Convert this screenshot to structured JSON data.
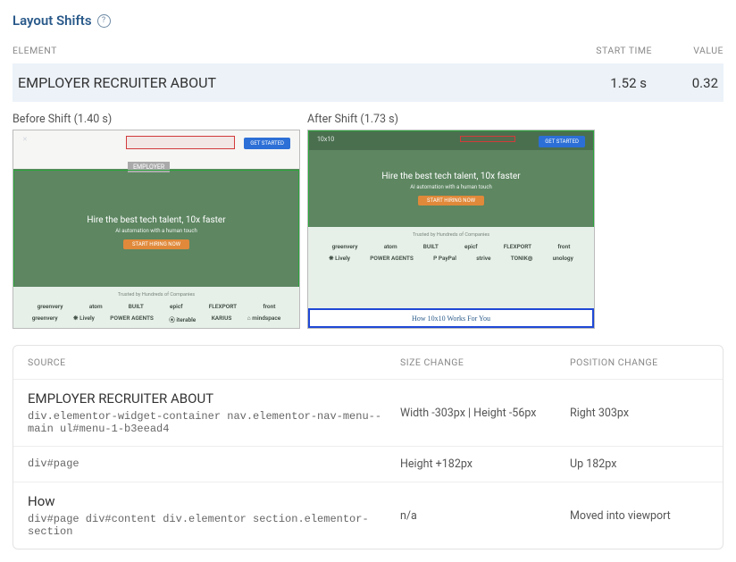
{
  "section": {
    "title": "Layout Shifts"
  },
  "header": {
    "element": "ELEMENT",
    "start": "START TIME",
    "value": "VALUE"
  },
  "selected": {
    "element": "EMPLOYER RECRUITER ABOUT",
    "start": "1.52 s",
    "value": "0.32"
  },
  "before": {
    "label": "Before Shift (1.40 s)"
  },
  "after": {
    "label": "After Shift (1.73 s)"
  },
  "preview": {
    "pill_employer": "EMPLOYER",
    "get_started": "GET STARTED",
    "headline": "Hire the best tech talent, 10x faster",
    "sub": "AI automation with a human touch",
    "cta": "START HIRING NOW",
    "trusted": "Trusted by Hundreds of Companies",
    "logo": "10x10",
    "works": "How 10x10 Works For You",
    "l": {
      "a1": "greenvery",
      "a2": "atom",
      "a3": "BUILT",
      "a4": "epicf",
      "a5": "FLEXPORT",
      "a6": "front",
      "b1": "❋ Lively",
      "b2": "POWER AGENTS",
      "b3": "P PayPal",
      "b4": "strive",
      "b5": "TONIK◎",
      "b6": "unology",
      "c1": "greenvery",
      "c2": "❋ Lively",
      "c3": "POWER AGENTS",
      "c4": "⦿ iterable",
      "c5": "KARIUS",
      "c6": "⌂ mindspace"
    }
  },
  "src": {
    "hdr": {
      "source": "SOURCE",
      "size": "SIZE CHANGE",
      "pos": "POSITION CHANGE"
    },
    "rows": [
      {
        "name": "EMPLOYER RECRUITER ABOUT",
        "path": "div.elementor-widget-container nav.elementor-nav-menu--main ul#menu-1-b3eead4",
        "size": "Width -303px | Height -56px",
        "pos": "Right 303px"
      },
      {
        "name": "",
        "path": "div#page",
        "size": "Height +182px",
        "pos": "Up 182px"
      },
      {
        "name": "How",
        "path": "div#page div#content div.elementor section.elementor-section",
        "size": "n/a",
        "pos": "Moved into viewport"
      }
    ]
  }
}
